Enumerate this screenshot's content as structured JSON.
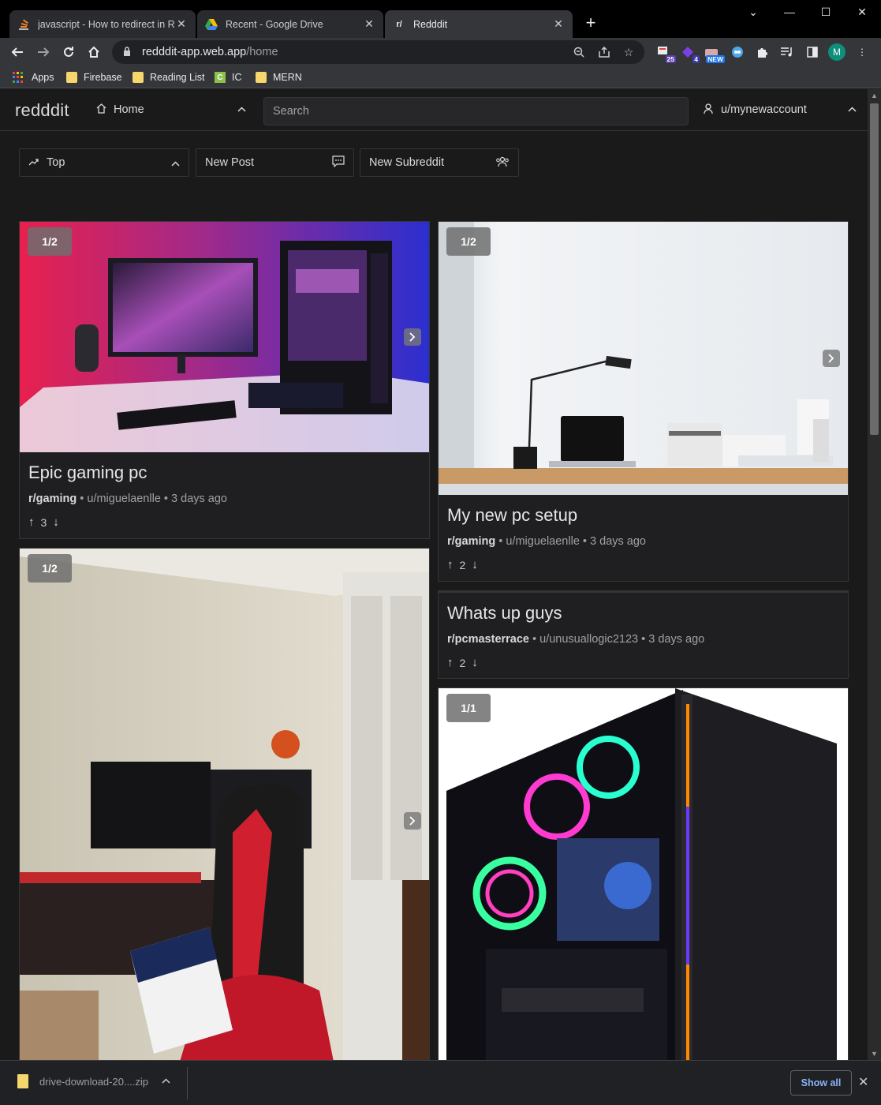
{
  "browser": {
    "tabs": [
      {
        "title": "javascript - How to redirect in Re",
        "icon": "stackoverflow-icon",
        "active": false
      },
      {
        "title": "Recent - Google Drive",
        "icon": "google-drive-icon",
        "active": false
      },
      {
        "title": "Redddit",
        "icon": "reddit-r-icon",
        "active": true
      }
    ],
    "favicon_r": "r/",
    "url_host": "redddit-app.web.app",
    "url_path": "/home",
    "extension_badges": {
      "ext1": "25",
      "ext2": "4",
      "ext3": "NEW"
    },
    "profile_initial": "M",
    "bookmarks": [
      {
        "label": "Apps",
        "icon": "apps-grid-icon"
      },
      {
        "label": "Firebase",
        "icon": "folder-icon"
      },
      {
        "label": "Reading List",
        "icon": "folder-icon"
      },
      {
        "label": "IC",
        "icon": "ic-icon"
      },
      {
        "label": "MERN",
        "icon": "folder-icon"
      }
    ],
    "ic_letter": "C"
  },
  "app": {
    "logo": "redddit",
    "home_label": "Home",
    "search_placeholder": "Search",
    "user_label": "u/mynewaccount",
    "actions": {
      "sort_label": "Top",
      "new_post_label": "New Post",
      "new_subreddit_label": "New Subreddit"
    }
  },
  "posts": [
    {
      "counter": "1/2",
      "title": "Epic gaming pc",
      "subreddit": "r/gaming",
      "author": "u/miguelaenlle",
      "time": "3 days ago",
      "sep": "•",
      "votes": "3",
      "image": "gaming-pc-desk-red-blue-lit"
    },
    {
      "counter": "1/2",
      "title": "My new pc setup",
      "subreddit": "r/gaming",
      "author": "u/miguelaenlle",
      "time": "3 days ago",
      "sep": "•",
      "votes": "2",
      "image": "minimal-desk-laptop-lamp"
    },
    {
      "counter": "1/2",
      "title": "",
      "image": "red-gaming-chair-dual-monitors"
    },
    {
      "title": "Whats up guys",
      "subreddit": "r/pcmasterrace",
      "author": "u/unusuallogic2123",
      "time": "3 days ago",
      "sep": "•",
      "votes": "2"
    },
    {
      "counter": "1/1",
      "title": "",
      "image": "rgb-pc-tower"
    }
  ],
  "download": {
    "filename": "drive-download-20....zip",
    "show_all": "Show all"
  },
  "colors": {
    "page_bg": "#1a1a1b",
    "card_bg": "#1f1f21",
    "border": "#343536",
    "text": "#d7dadc",
    "link": "#8ab4f8"
  }
}
